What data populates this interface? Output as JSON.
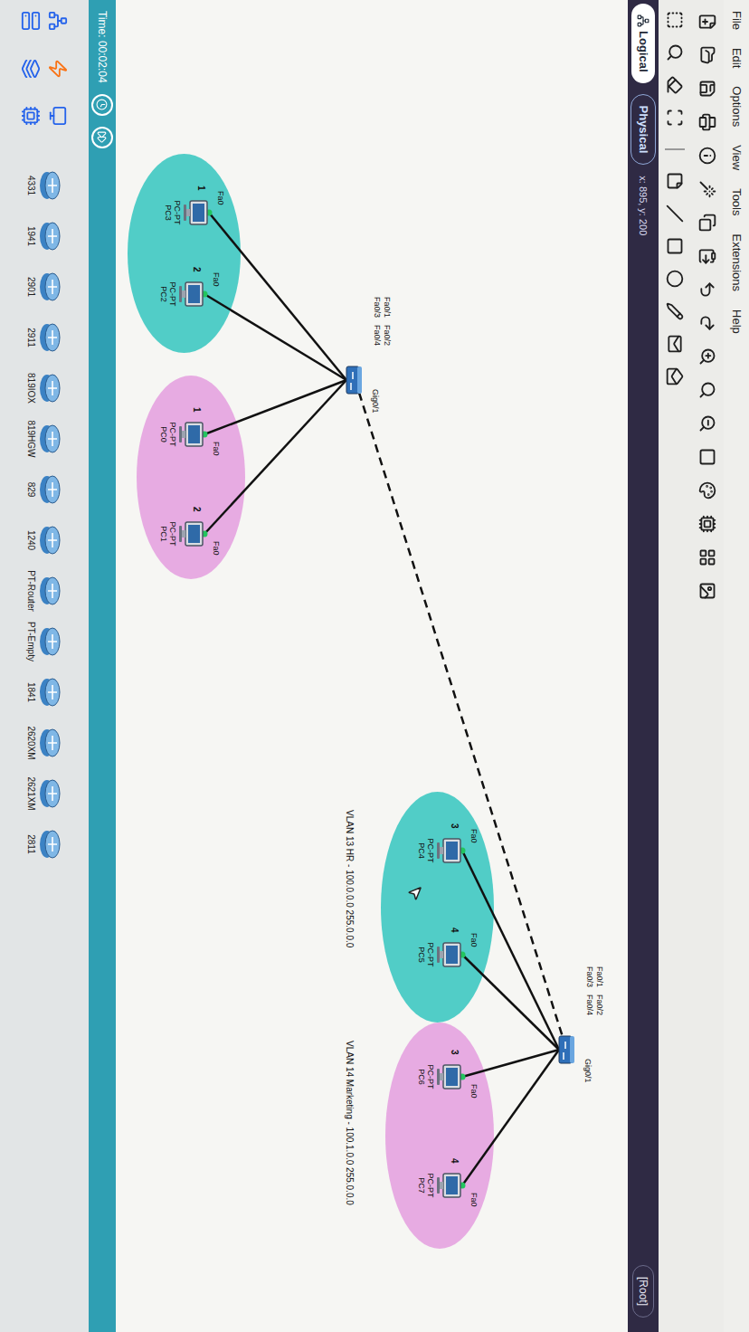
{
  "menu": [
    "File",
    "Edit",
    "Options",
    "View",
    "Tools",
    "Extensions",
    "Help"
  ],
  "view_tabs": [
    {
      "label": "Logical",
      "selected": true
    },
    {
      "label": "Physical",
      "selected": false
    }
  ],
  "cursor_position": "x: 895, y: 200",
  "breadcrumb": "[Root]",
  "switches": [
    {
      "uplink": "Gig0/1",
      "ports": [
        "Fa0/1",
        "Fa0/2",
        "Fa0/3",
        "Fa0/4"
      ],
      "groups": [
        {
          "color": "#3fc9c2",
          "label": "",
          "pcs": [
            {
              "number": "1",
              "type": "PC-PT",
              "name": "PC3",
              "port": "Fa0"
            },
            {
              "number": "2",
              "type": "PC-PT",
              "name": "PC2",
              "port": "Fa0"
            }
          ]
        },
        {
          "color": "#e6a3e0",
          "label": "",
          "pcs": [
            {
              "number": "1",
              "type": "PC-PT",
              "name": "PC0",
              "port": "Fa0"
            },
            {
              "number": "2",
              "type": "PC-PT",
              "name": "PC1",
              "port": "Fa0"
            }
          ]
        }
      ]
    },
    {
      "uplink": "Gig0/1",
      "ports": [
        "Fa0/1",
        "Fa0/2",
        "Fa0/3",
        "Fa0/4"
      ],
      "groups": [
        {
          "color": "#3fc9c2",
          "label": "VLAN 13 HR - 100.0.0.0 255.0.0.0",
          "pcs": [
            {
              "number": "3",
              "type": "PC-PT",
              "name": "PC4",
              "port": "Fa0"
            },
            {
              "number": "4",
              "type": "PC-PT",
              "name": "PC5",
              "port": "Fa0"
            }
          ]
        },
        {
          "color": "#e6a3e0",
          "label": "VLAN 14 Marketing - 100.1.0.0 255.0.0.0",
          "pcs": [
            {
              "number": "3",
              "type": "PC-PT",
              "name": "PC6",
              "port": "Fa0"
            },
            {
              "number": "4",
              "type": "PC-PT",
              "name": "PC7",
              "port": "Fa0"
            }
          ]
        }
      ]
    }
  ],
  "timeline": {
    "time": "Time: 00:02:04"
  },
  "devices": [
    "4331",
    "1941",
    "2901",
    "2911",
    "819IOX",
    "819HGW",
    "829",
    "1240",
    "PT-Router",
    "PT-Empty",
    "1841",
    "2620XM",
    "2621XM",
    "2811"
  ]
}
